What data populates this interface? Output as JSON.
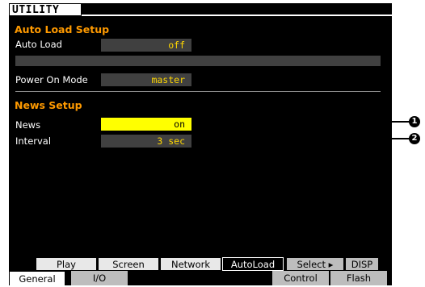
{
  "screen": {
    "title": "UTILITY"
  },
  "auto_load_setup": {
    "title": "Auto Load Setup",
    "auto_load": {
      "label": "Auto Load",
      "value": "off"
    },
    "power_on_mode": {
      "label": "Power On Mode",
      "value": "master"
    }
  },
  "news_setup": {
    "title": "News Setup",
    "news": {
      "label": "News",
      "value": "on"
    },
    "interval": {
      "label": "Interval",
      "value": "3 sec"
    }
  },
  "tabs_row1": [
    "Play",
    "Screen",
    "Network",
    "AutoLoad",
    "Select ▸",
    "DISP"
  ],
  "tabs_row2": [
    "General",
    "I/O",
    "Control",
    "Flash"
  ],
  "callouts": [
    "1",
    "2"
  ],
  "colors": {
    "section_title": "#ff9a00",
    "value_text": "#ffd700",
    "highlight": "#ffff00",
    "field_bg": "#404040"
  }
}
